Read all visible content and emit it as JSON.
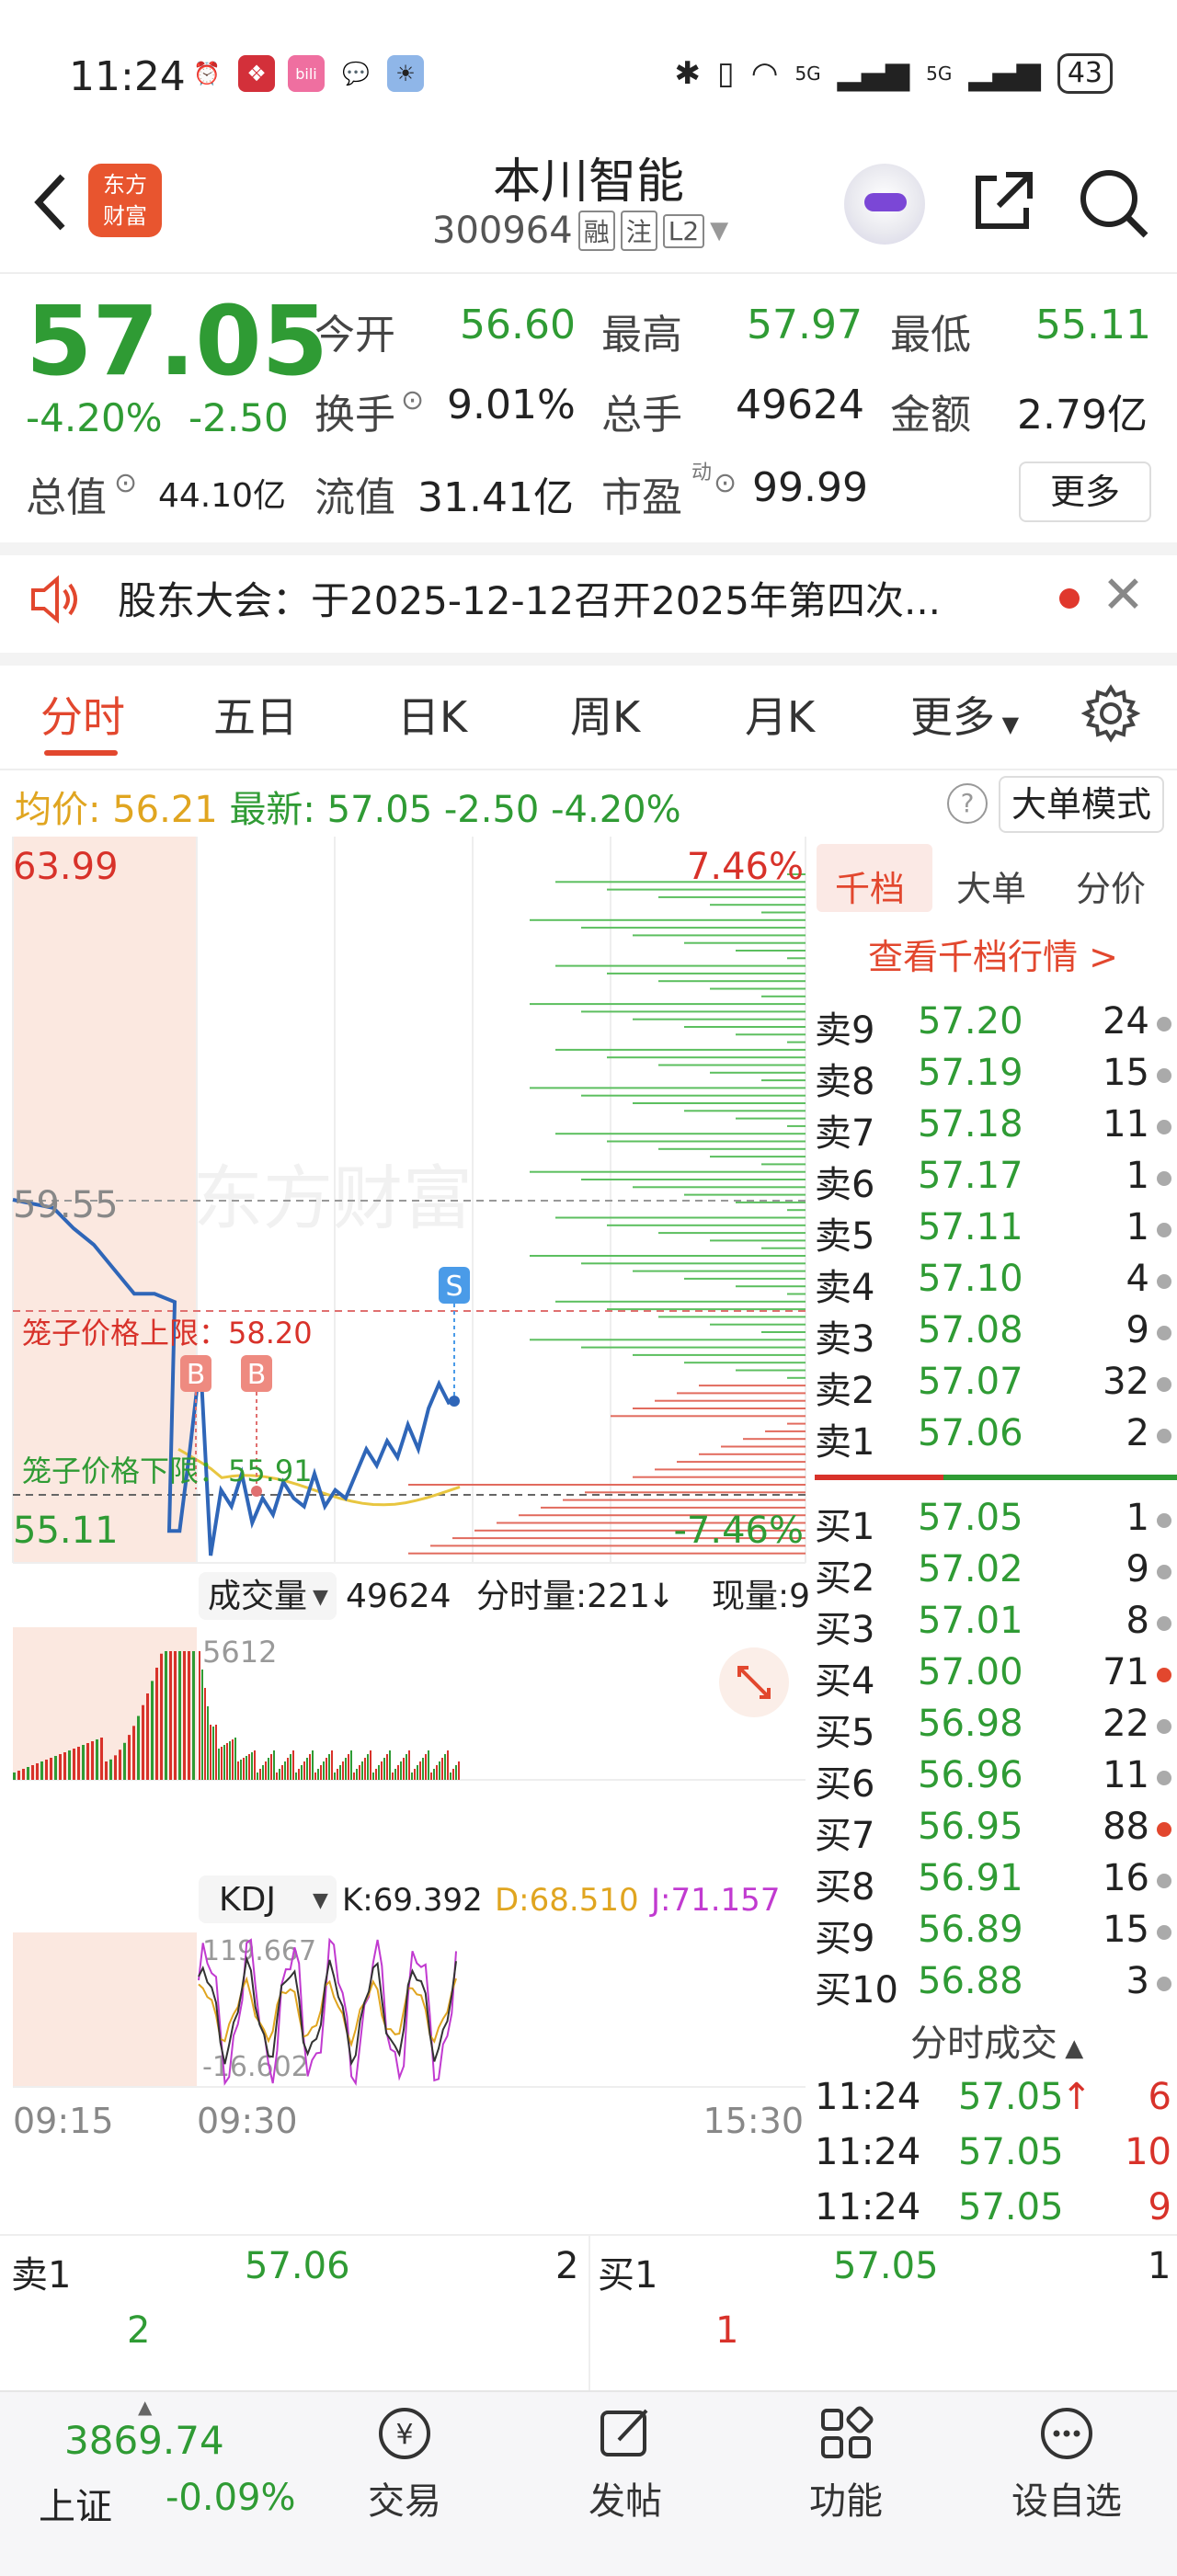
{
  "status_bar": {
    "time": "11:24",
    "signal1": "5G",
    "signal2": "5G",
    "battery": "43"
  },
  "header": {
    "title": "本川智能",
    "code": "300964",
    "tags": [
      "融",
      "注",
      "L2"
    ],
    "logo_line1": "东方",
    "logo_line2": "财富"
  },
  "quote": {
    "price": "57.05",
    "change_pct": "-4.20%",
    "change_val": "-2.50",
    "open_label": "今开",
    "open": "56.60",
    "high_label": "最高",
    "high": "57.97",
    "low_label": "最低",
    "low": "55.11",
    "turnover_label": "换手",
    "turnover": "9.01%",
    "volume_label": "总手",
    "volume": "49624",
    "amount_label": "金额",
    "amount": "2.79亿",
    "mcap_label": "总值",
    "mcap": "44.10亿",
    "float_label": "流值",
    "float": "31.41亿",
    "pe_label": "市盈",
    "pe_sup": "动",
    "pe": "99.99",
    "more": "更多"
  },
  "notice": {
    "text": "股东大会：于2025-12-12召开2025年第四次..."
  },
  "tabs": [
    "分时",
    "五日",
    "日K",
    "周K",
    "月K",
    "更多"
  ],
  "info_row": {
    "avg_label": "均价:",
    "avg": "56.21",
    "latest_label": "最新:",
    "latest": "57.05",
    "chg": "-2.50",
    "pct": "-4.20%",
    "mode_button": "大单模式",
    "help": "?"
  },
  "chart_data": {
    "type": "line",
    "y_top": "63.99",
    "y_bottom": "55.11",
    "pct_top": "7.46%",
    "pct_bottom": "-7.46%",
    "prev_close": "59.55",
    "cage_upper_label": "笼子价格上限：58.20",
    "cage_lower_label": "笼子价格下限：55.91",
    "marker_b": "B",
    "marker_s": "S",
    "watermark": "东方财富",
    "ylim": [
      55.11,
      63.99
    ],
    "price_series": [
      59.55,
      59.5,
      59.45,
      59.2,
      59.0,
      58.7,
      58.4,
      58.4,
      58.3,
      55.5,
      55.5,
      56.5,
      57.6,
      55.2,
      56.0,
      55.8,
      56.2,
      55.6,
      55.9,
      55.7,
      56.1,
      55.9,
      55.8,
      56.2,
      55.8,
      56.0,
      55.9,
      56.2,
      56.5,
      56.3,
      56.6,
      56.4,
      56.8,
      56.5,
      57.0,
      57.3,
      57.05
    ],
    "volume_label": "成交量",
    "volume_total": "49624",
    "tick_vol_label": "分时量:221",
    "now_vol_label": "现量:9",
    "volume_max_label": "5612",
    "kdj_label": "KDJ",
    "k": "K:69.392",
    "d": "D:68.510",
    "j": "J:71.157",
    "kdj_max": "119.667",
    "kdj_min": "-16.602",
    "x_ticks": [
      "09:15",
      "09:30",
      "15:30"
    ]
  },
  "order_book": {
    "tabs": [
      "千档",
      "大单",
      "分价"
    ],
    "link": "查看千档行情 >",
    "asks": [
      {
        "label": "卖9",
        "price": "57.20",
        "qty": "24"
      },
      {
        "label": "卖8",
        "price": "57.19",
        "qty": "15"
      },
      {
        "label": "卖7",
        "price": "57.18",
        "qty": "11"
      },
      {
        "label": "卖6",
        "price": "57.17",
        "qty": "1"
      },
      {
        "label": "卖5",
        "price": "57.11",
        "qty": "1"
      },
      {
        "label": "卖4",
        "price": "57.10",
        "qty": "4"
      },
      {
        "label": "卖3",
        "price": "57.08",
        "qty": "9"
      },
      {
        "label": "卖2",
        "price": "57.07",
        "qty": "32"
      },
      {
        "label": "卖1",
        "price": "57.06",
        "qty": "2"
      }
    ],
    "bids": [
      {
        "label": "买1",
        "price": "57.05",
        "qty": "1"
      },
      {
        "label": "买2",
        "price": "57.02",
        "qty": "9"
      },
      {
        "label": "买3",
        "price": "57.01",
        "qty": "8"
      },
      {
        "label": "买4",
        "price": "57.00",
        "qty": "71"
      },
      {
        "label": "买5",
        "price": "56.98",
        "qty": "22"
      },
      {
        "label": "买6",
        "price": "56.96",
        "qty": "11"
      },
      {
        "label": "买7",
        "price": "56.95",
        "qty": "88"
      },
      {
        "label": "买8",
        "price": "56.91",
        "qty": "16"
      },
      {
        "label": "买9",
        "price": "56.89",
        "qty": "15"
      },
      {
        "label": "买10",
        "price": "56.88",
        "qty": "3"
      }
    ],
    "ticks_header": "分时成交",
    "ticks": [
      {
        "time": "11:24",
        "price": "57.05",
        "qty": "6"
      },
      {
        "time": "11:24",
        "price": "57.05",
        "qty": "10"
      },
      {
        "time": "11:24",
        "price": "57.05",
        "qty": "9"
      }
    ]
  },
  "bottom_orders": {
    "ask_label": "卖1",
    "ask_price": "57.06",
    "ask_qty": "2",
    "ask_count": "2",
    "bid_label": "买1",
    "bid_price": "57.05",
    "bid_qty": "1",
    "bid_count": "1"
  },
  "nav": {
    "index_value": "3869.74",
    "index_name": "上证",
    "index_pct": "-0.09%",
    "items": [
      "交易",
      "发帖",
      "功能",
      "设自选"
    ]
  }
}
